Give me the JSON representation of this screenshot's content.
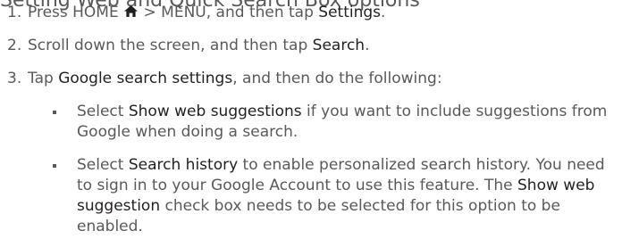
{
  "heading": "Setting Web and Quick Search Box options",
  "steps": [
    {
      "number": "1.",
      "parts": [
        "Press HOME",
        " > MENU, and then tap ",
        "Settings",
        "."
      ]
    },
    {
      "number": "2.",
      "parts": [
        "Scroll down the screen, and then tap ",
        "Search",
        "."
      ]
    },
    {
      "number": "3.",
      "parts": [
        "Tap ",
        "Google search settings",
        ", and then do the following:"
      ]
    }
  ],
  "bullets": [
    {
      "parts": [
        "Select ",
        "Show web suggestions",
        " if you want to include suggestions from Google when doing a search."
      ]
    },
    {
      "parts": [
        "Select ",
        "Search history",
        " to enable personalized search history. You need to sign in to your Google Account to use this feature. The ",
        "Show web suggestion",
        " check box needs to be selected for this option to be enabled."
      ]
    }
  ],
  "icons": {
    "home": "home-icon"
  },
  "colors": {
    "body_text": "#58595b",
    "ui_term": "#231f20"
  }
}
